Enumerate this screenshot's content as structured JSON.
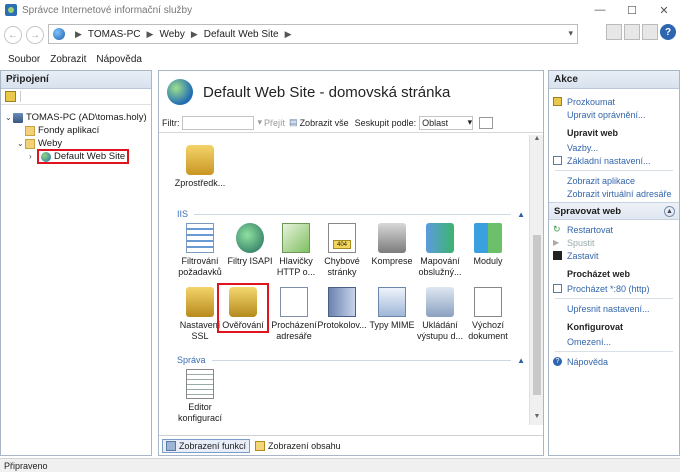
{
  "window": {
    "title": "Správce Internetové informační služby",
    "controls": [
      "minimize",
      "maximize",
      "close"
    ]
  },
  "address": {
    "crumbs": [
      "TOMAS-PC",
      "Weby",
      "Default Web Site"
    ]
  },
  "menu": [
    "Soubor",
    "Zobrazit",
    "Nápověda"
  ],
  "connections": {
    "header": "Připojení",
    "tree": [
      {
        "label": "TOMAS-PC (AD\\tomas.holy)",
        "icon": "server-icon",
        "toggle": "⌄"
      },
      {
        "label": "Fondy aplikací",
        "icon": "app-pools-icon",
        "toggle": ""
      },
      {
        "label": "Weby",
        "icon": "sites-folder-icon",
        "toggle": "⌄"
      },
      {
        "label": "Default Web Site",
        "icon": "globe-icon",
        "toggle": "›"
      }
    ]
  },
  "center": {
    "title": "Default Web Site - domovská stránka",
    "filter": {
      "label": "Filtr:",
      "value": "",
      "go_label": "Přejít",
      "show_all_label": "Zobrazit vše",
      "group_label": "Seskupit podle:",
      "group_value": "Oblast"
    },
    "top_features": [
      {
        "label": "Zprostředk...",
        "icon": "delegation-icon"
      }
    ],
    "sections": [
      {
        "name": "IIS",
        "features": [
          {
            "label": "Filtrování požadavků",
            "icon": "request-filtering-icon"
          },
          {
            "label": "Filtry ISAPI",
            "icon": "isapi-filters-icon"
          },
          {
            "label": "Hlavičky HTTP o...",
            "icon": "http-headers-icon"
          },
          {
            "label": "Chybové stránky",
            "icon": "error-pages-icon"
          },
          {
            "label": "Komprese",
            "icon": "compression-icon"
          },
          {
            "label": "Mapování obslužný...",
            "icon": "handler-mappings-icon"
          },
          {
            "label": "Moduly",
            "icon": "modules-icon"
          },
          {
            "label": "Nastavení SSL",
            "icon": "ssl-icon"
          },
          {
            "label": "Ověřování",
            "icon": "authentication-icon",
            "highlighted": true
          },
          {
            "label": "Procházení adresáře",
            "icon": "directory-browsing-icon"
          },
          {
            "label": "Protokolov...",
            "icon": "logging-icon"
          },
          {
            "label": "Typy MIME",
            "icon": "mime-types-icon"
          },
          {
            "label": "Ukládání výstupu d...",
            "icon": "output-caching-icon"
          },
          {
            "label": "Výchozí dokument",
            "icon": "default-document-icon"
          }
        ]
      },
      {
        "name": "Správa",
        "features": [
          {
            "label": "Editor konfigurací",
            "icon": "config-editor-icon"
          }
        ]
      }
    ],
    "view_tabs": [
      {
        "label": "Zobrazení funkcí",
        "active": true
      },
      {
        "label": "Zobrazení obsahu",
        "active": false
      }
    ]
  },
  "actions": {
    "header": "Akce",
    "top": [
      {
        "label": "Prozkoumat",
        "icon": "explore-icon"
      },
      {
        "label": "Upravit oprávnění...",
        "icon": ""
      }
    ],
    "edit_site": {
      "title": "Upravit web",
      "items": [
        {
          "label": "Vazby...",
          "icon": ""
        },
        {
          "label": "Základní nastavení...",
          "icon": "basic-settings-icon"
        }
      ]
    },
    "apps": [
      {
        "label": "Zobrazit aplikace"
      },
      {
        "label": "Zobrazit virtuální adresáře"
      }
    ],
    "manage": {
      "title": "Spravovat web",
      "items": [
        {
          "label": "Restartovat",
          "icon": "restart-icon",
          "disabled": false
        },
        {
          "label": "Spustit",
          "icon": "start-icon",
          "disabled": true
        },
        {
          "label": "Zastavit",
          "icon": "stop-icon",
          "disabled": false
        }
      ],
      "browse_title": "Procházet web",
      "browse_link": "Procházet *:80 (http)",
      "advanced": "Upřesnit nastavení...",
      "configure_title": "Konfigurovat",
      "limits": "Omezení...",
      "help": "Nápověda"
    }
  },
  "status": {
    "text": "Připraveno"
  },
  "colors": {
    "accent": "#3366aa",
    "highlight": "#e0141e",
    "section": "#3a6eb0"
  }
}
